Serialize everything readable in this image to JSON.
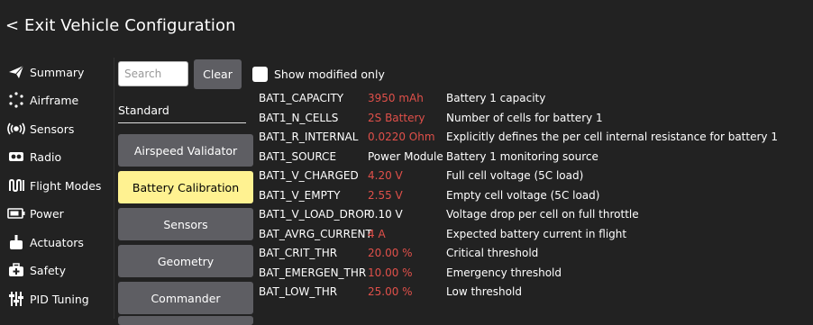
{
  "header": {
    "exit_label": "< Exit Vehicle Configuration"
  },
  "sidebar": {
    "items": [
      {
        "label": "Summary",
        "icon": "paper-plane-icon"
      },
      {
        "label": "Airframe",
        "icon": "airframe-icon"
      },
      {
        "label": "Sensors",
        "icon": "sensors-icon"
      },
      {
        "label": "Radio",
        "icon": "radio-icon"
      },
      {
        "label": "Flight Modes",
        "icon": "flight-modes-icon"
      },
      {
        "label": "Power",
        "icon": "battery-icon"
      },
      {
        "label": "Actuators",
        "icon": "actuators-icon"
      },
      {
        "label": "Safety",
        "icon": "safety-icon"
      },
      {
        "label": "PID Tuning",
        "icon": "pid-tuning-icon"
      }
    ]
  },
  "filters": {
    "search_placeholder": "Search",
    "clear_label": "Clear",
    "show_modified_label": "Show modified only",
    "show_modified_checked": false
  },
  "groups": {
    "section_label": "Standard",
    "buttons": [
      {
        "label": "Airspeed Validator",
        "active": false
      },
      {
        "label": "Battery Calibration",
        "active": true
      },
      {
        "label": "Sensors",
        "active": false
      },
      {
        "label": "Geometry",
        "active": false
      },
      {
        "label": "Commander",
        "active": false
      }
    ]
  },
  "params": [
    {
      "name": "BAT1_CAPACITY",
      "value": "3950 mAh",
      "modified": true,
      "desc": "Battery 1 capacity"
    },
    {
      "name": "BAT1_N_CELLS",
      "value": "2S Battery",
      "modified": true,
      "desc": "Number of cells for battery 1"
    },
    {
      "name": "BAT1_R_INTERNAL",
      "value": "0.0220 Ohm",
      "modified": true,
      "desc": "Explicitly defines the per cell internal resistance for battery 1"
    },
    {
      "name": "BAT1_SOURCE",
      "value": "Power Module",
      "modified": false,
      "desc": "Battery 1 monitoring source"
    },
    {
      "name": "BAT1_V_CHARGED",
      "value": "4.20 V",
      "modified": true,
      "desc": "Full cell voltage (5C load)"
    },
    {
      "name": "BAT1_V_EMPTY",
      "value": "2.55 V",
      "modified": true,
      "desc": "Empty cell voltage (5C load)"
    },
    {
      "name": "BAT1_V_LOAD_DROP",
      "value": "0.10 V",
      "modified": false,
      "desc": "Voltage drop per cell on full throttle"
    },
    {
      "name": "BAT_AVRG_CURRENT",
      "value": "4 A",
      "modified": true,
      "desc": "Expected battery current in flight"
    },
    {
      "name": "BAT_CRIT_THR",
      "value": "20.00 %",
      "modified": true,
      "desc": "Critical threshold"
    },
    {
      "name": "BAT_EMERGEN_THR",
      "value": "10.00 %",
      "modified": true,
      "desc": "Emergency threshold"
    },
    {
      "name": "BAT_LOW_THR",
      "value": "25.00 %",
      "modified": true,
      "desc": "Low threshold"
    }
  ],
  "colors": {
    "background": "#222222",
    "button": "#5e5e63",
    "active_button": "#fff291",
    "modified_value": "#e0504a"
  }
}
